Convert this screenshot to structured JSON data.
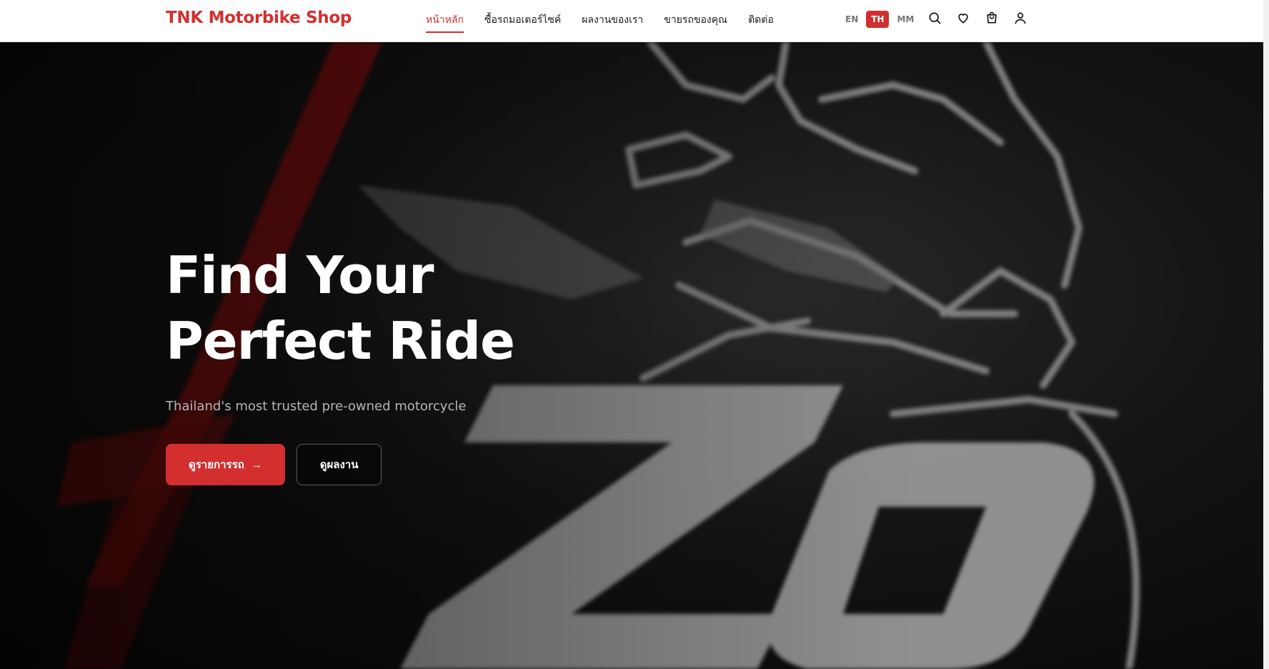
{
  "brand": {
    "name": "TNK Motorbike Shop",
    "color": "#d32f2f"
  },
  "nav": {
    "items": [
      {
        "label": "หน้าหลัก",
        "active": true
      },
      {
        "label": "ซื้อรถมอเตอร์ไซค์",
        "active": false
      },
      {
        "label": "ผลงานของเรา",
        "active": false
      },
      {
        "label": "ขายรถของคุณ",
        "active": false
      },
      {
        "label": "ติดต่อ",
        "active": false
      }
    ]
  },
  "languages": {
    "options": [
      "EN",
      "TH",
      "MM"
    ],
    "selected": "TH"
  },
  "header_icons": [
    "search-icon",
    "heart-icon",
    "shopping-bag-icon",
    "user-icon"
  ],
  "hero": {
    "title_line1": "Find Your",
    "title_line2": "Perfect Ride",
    "subtitle": "Thailand's most trusted pre-owned motorcycle",
    "primary_button": "ดูรายการรถ",
    "primary_arrow": "→",
    "secondary_button": "ดูผลงาน"
  },
  "colors": {
    "accent": "#d32f2f",
    "hero_bg": "#0a0a0a",
    "header_bg": "#ffffff"
  }
}
